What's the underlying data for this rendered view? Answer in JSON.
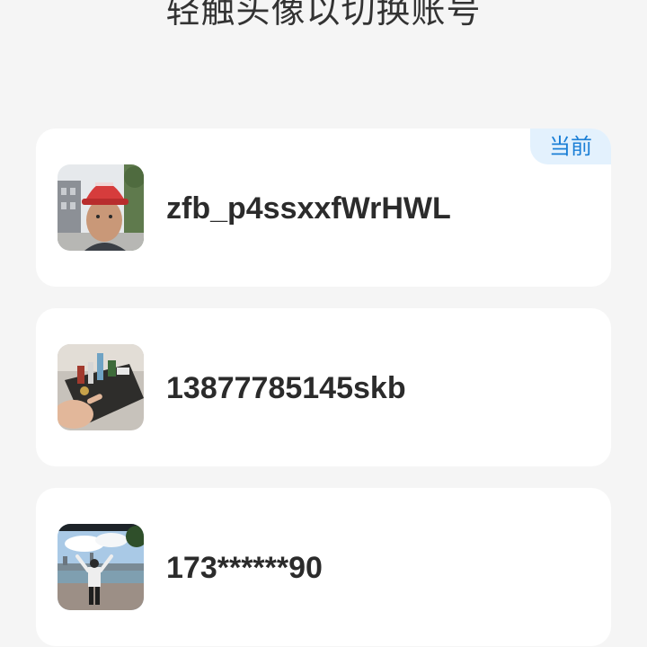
{
  "header": {
    "title": "轻触头像以切换账号"
  },
  "accounts": [
    {
      "name": "zfb_p4ssxxfWrHWL",
      "badge": "当前",
      "avatar_icon": "construction-helmet-photo"
    },
    {
      "name": "13877785145skb",
      "avatar_icon": "desk-items-photo"
    },
    {
      "name": "173******90",
      "avatar_icon": "outdoor-person-photo"
    }
  ],
  "colors": {
    "background": "#f5f5f5",
    "card": "#ffffff",
    "badge_bg": "#e3f1fd",
    "badge_text": "#1b7fd6",
    "text": "#2b2b2b"
  }
}
